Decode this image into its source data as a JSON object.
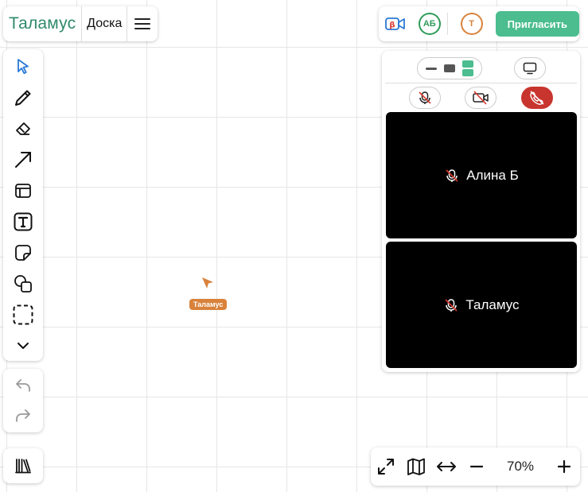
{
  "header": {
    "logo": "Таламус",
    "board_title": "Доска"
  },
  "participants_bar": {
    "beta_label": "β",
    "avatars": [
      {
        "initials": "АБ",
        "color": "#2f9a5a"
      },
      {
        "initials": "Т",
        "color": "#d9823b"
      }
    ],
    "invite_label": "Пригласить",
    "accent": "#4bbd8e"
  },
  "toolbar": {
    "tools": [
      {
        "icon": "select-pointer-icon",
        "active": true
      },
      {
        "icon": "pencil-icon"
      },
      {
        "icon": "eraser-icon"
      },
      {
        "icon": "arrow-icon"
      },
      {
        "icon": "frame-icon"
      },
      {
        "icon": "text-icon"
      },
      {
        "icon": "sticky-note-icon"
      },
      {
        "icon": "shapes-icon"
      },
      {
        "icon": "selection-area-icon"
      },
      {
        "icon": "chevron-down-icon"
      }
    ],
    "history": [
      "undo-icon",
      "redo-icon"
    ],
    "library_icon": "library-books-icon"
  },
  "video": {
    "tiles": [
      {
        "name": "Алина Б",
        "mic_muted": true
      },
      {
        "name": "Таламус",
        "mic_muted": true
      }
    ],
    "hangup_color": "#c8352e"
  },
  "canvas": {
    "cursor_user": "Таламус",
    "cursor_color": "#d9823b"
  },
  "zoom": {
    "level": "70%"
  }
}
